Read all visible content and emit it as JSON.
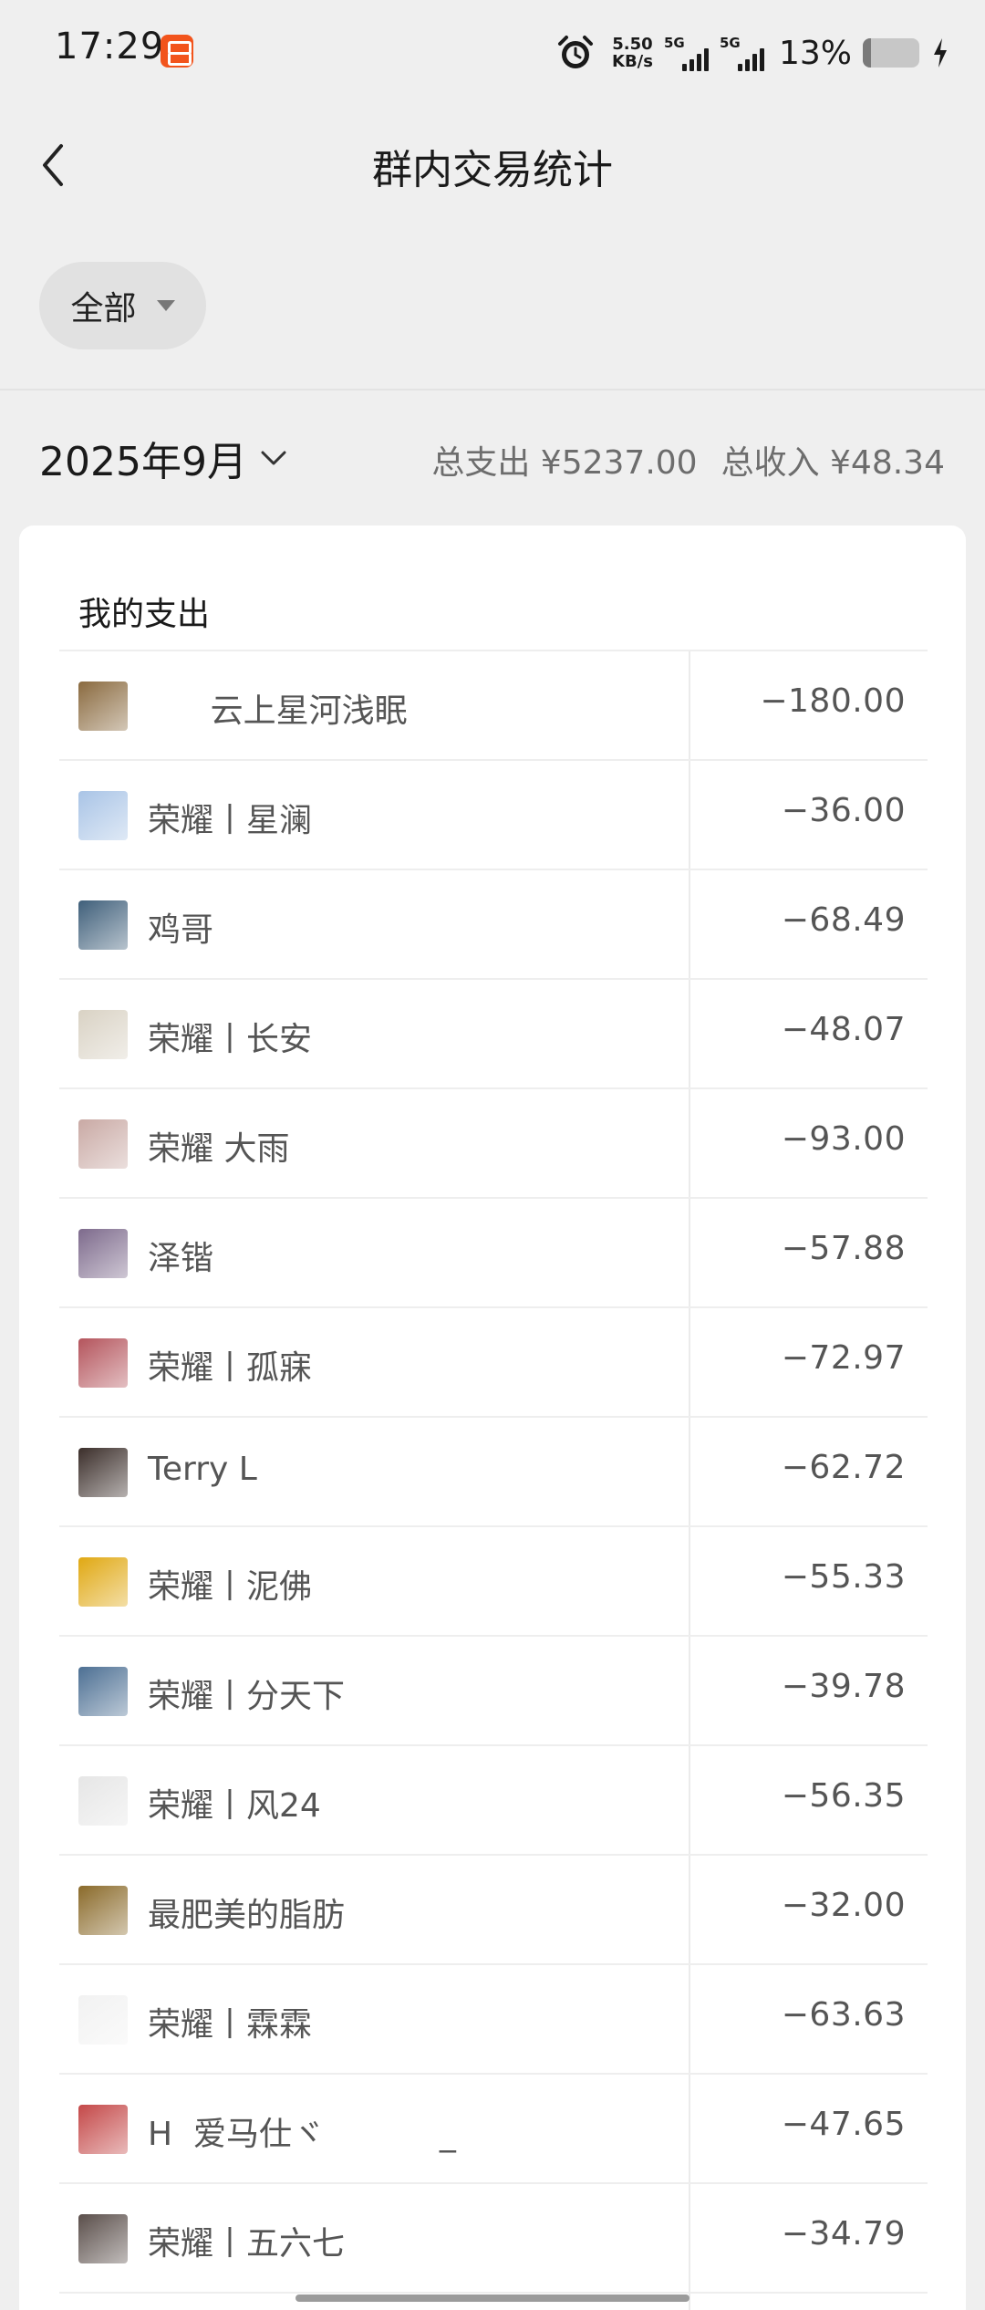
{
  "status_bar": {
    "time": "17:29",
    "speed_value": "5.50",
    "speed_unit": "KB/s",
    "sim1_label": "5G",
    "sim2_label": "5G",
    "battery_percent": "13%",
    "battery_level": 0.13
  },
  "header": {
    "title": "群内交易统计"
  },
  "filter": {
    "label": "全部"
  },
  "summary": {
    "month": "2025年9月",
    "total_expense": "总支出 ¥5237.00",
    "total_income": "总收入 ¥48.34"
  },
  "section": {
    "title": "我的支出",
    "rows": [
      {
        "name": "      云上星河浅眠",
        "amount": "−180.00",
        "avatar_color": "#8a6a3f"
      },
      {
        "name": "荣耀丨星澜",
        "amount": "−36.00",
        "avatar_color": "#a9c4e6"
      },
      {
        "name": "鸡哥",
        "amount": "−68.49",
        "avatar_color": "#3f5f7a"
      },
      {
        "name": "荣耀丨长安",
        "amount": "−48.07",
        "avatar_color": "#d9d2c4"
      },
      {
        "name": "荣耀 大雨",
        "amount": "−93.00",
        "avatar_color": "#c9a9a4"
      },
      {
        "name": "泽锴",
        "amount": "−57.88",
        "avatar_color": "#7d6a8c"
      },
      {
        "name": "荣耀丨孤寐",
        "amount": "−72.97",
        "avatar_color": "#b4545c"
      },
      {
        "name": "Terry L",
        "amount": "−62.72",
        "avatar_color": "#3b2e2a"
      },
      {
        "name": "荣耀丨泥佛",
        "amount": "−55.33",
        "avatar_color": "#e0a812"
      },
      {
        "name": "荣耀丨分天下",
        "amount": "−39.78",
        "avatar_color": "#4c6f93"
      },
      {
        "name": "荣耀丨风24",
        "amount": "−56.35",
        "avatar_color": "#e6e6e6"
      },
      {
        "name": "最肥美的脂肪",
        "amount": "−32.00",
        "avatar_color": "#8a6a2a"
      },
      {
        "name": "荣耀丨霖霖",
        "amount": "−63.63",
        "avatar_color": "#f2f2f2"
      },
      {
        "name": "H  爱马仕ヾ           _",
        "amount": "−47.65",
        "avatar_color": "#c44848"
      },
      {
        "name": "荣耀丨五六七",
        "amount": "−34.79",
        "avatar_color": "#5a4e4a"
      }
    ]
  }
}
